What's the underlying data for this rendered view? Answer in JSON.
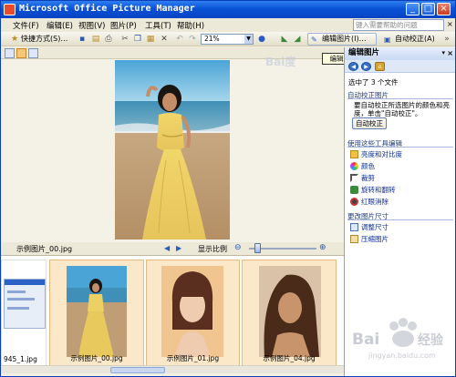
{
  "window": {
    "title": "Microsoft Office Picture Manager",
    "minimize": "_",
    "maximize": "□",
    "close": "×"
  },
  "menu": {
    "items": [
      {
        "label": "文件(F)"
      },
      {
        "label": "编辑(E)"
      },
      {
        "label": "视图(V)"
      },
      {
        "label": "图片(P)"
      },
      {
        "label": "工具(T)"
      },
      {
        "label": "帮助(H)"
      }
    ],
    "help_search_placeholder": "键入需要帮助的问题",
    "help_close": "×"
  },
  "toolbar": {
    "shortcuts": "快捷方式(S)…",
    "zoom": "21%",
    "edit_pictures": "编辑图片(I)…",
    "auto_correct": "自动校正(A)"
  },
  "tooltip": "编辑图片",
  "viewer": {
    "filename": "示例图片_00.jpg",
    "zoom_label": "显示比例",
    "zoom_out": "⊖",
    "zoom_in": "⊕"
  },
  "filmstrip": {
    "partial_label": "945_1.jpg",
    "thumbnails": [
      {
        "label": "示例图片_00.jpg"
      },
      {
        "label": "示例图片_01.jpg"
      },
      {
        "label": "示例图片_04.jpg"
      }
    ]
  },
  "taskpane": {
    "title": "编辑图片",
    "selected": "选中了 3 个文件",
    "auto_correct_heading": "自动校正图片",
    "auto_correct_desc_line1": "要自动校正所选图片的颜色和亮",
    "auto_correct_desc_line2": "度，单击\"自动校正\"。",
    "auto_correct_button": "自动校正",
    "tools_heading": "使用这些工具编辑",
    "tools": [
      {
        "label": "亮度和对比度"
      },
      {
        "label": "颜色"
      },
      {
        "label": "裁剪"
      },
      {
        "label": "旋转和翻转"
      },
      {
        "label": "红眼消除"
      }
    ],
    "resize_heading": "更改图片尺寸",
    "resize_tools": [
      {
        "label": "调整尺寸"
      },
      {
        "label": "压缩图片"
      }
    ]
  },
  "colors": {
    "titlebar": "#0a52d6",
    "link": "#0a2c9c",
    "selection": "#e3b97d"
  }
}
